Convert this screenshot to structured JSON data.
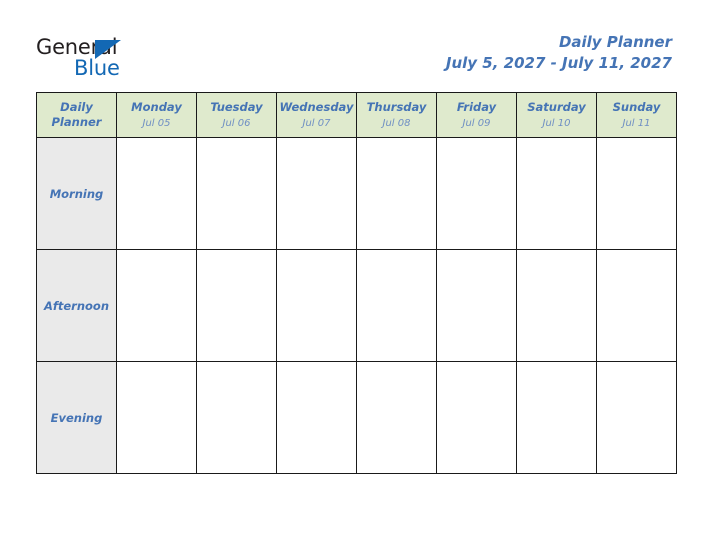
{
  "brand": {
    "name_top": "General",
    "name_bottom": "Blue",
    "triangle_color": "#1368b4",
    "top_text_color": "#231f20"
  },
  "header": {
    "title": "Daily Planner",
    "date_range": "July 5, 2027 - July 11, 2027",
    "accent_color": "#4574b5"
  },
  "table": {
    "corner": {
      "line1": "Daily",
      "line2": "Planner"
    },
    "header_bg": "#dfeacd",
    "label_bg": "#eaeaea",
    "border_color": "#1a1a1a",
    "columns": [
      {
        "day": "Monday",
        "date": "Jul 05"
      },
      {
        "day": "Tuesday",
        "date": "Jul 06"
      },
      {
        "day": "Wednesday",
        "date": "Jul 07"
      },
      {
        "day": "Thursday",
        "date": "Jul 08"
      },
      {
        "day": "Friday",
        "date": "Jul 09"
      },
      {
        "day": "Saturday",
        "date": "Jul 10"
      },
      {
        "day": "Sunday",
        "date": "Jul 11"
      }
    ],
    "rows": [
      {
        "label": "Morning",
        "cells": [
          "",
          "",
          "",
          "",
          "",
          "",
          ""
        ]
      },
      {
        "label": "Afternoon",
        "cells": [
          "",
          "",
          "",
          "",
          "",
          "",
          ""
        ]
      },
      {
        "label": "Evening",
        "cells": [
          "",
          "",
          "",
          "",
          "",
          "",
          ""
        ]
      }
    ]
  }
}
